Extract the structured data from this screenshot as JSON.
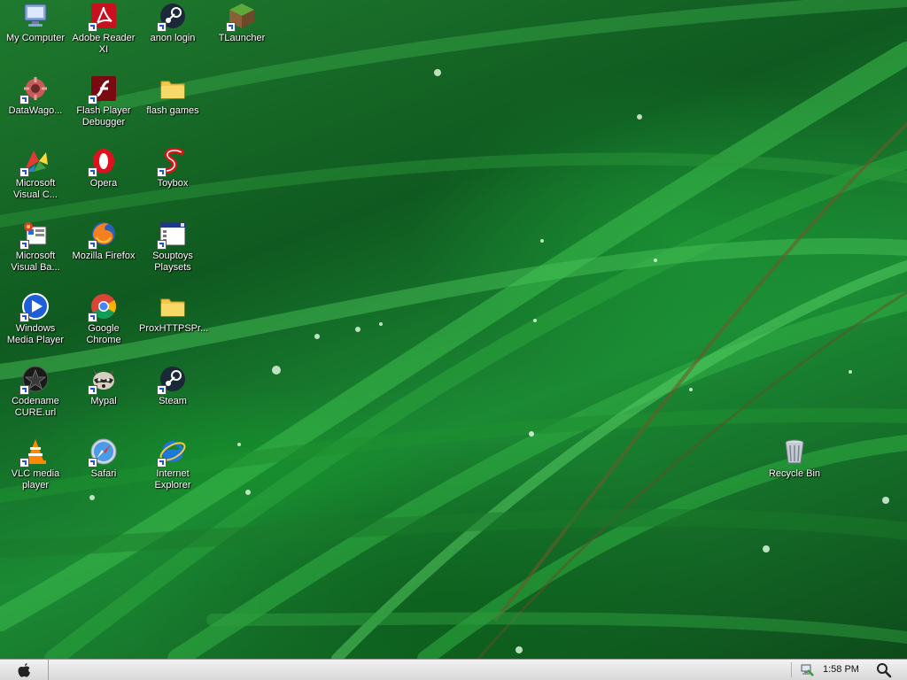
{
  "desktop": {
    "icons": [
      {
        "label": "My Computer",
        "icon": "my-computer-icon"
      },
      {
        "label": "Adobe Reader XI",
        "icon": "adobe-reader-icon"
      },
      {
        "label": "anon login",
        "icon": "steam-icon"
      },
      {
        "label": "TLauncher",
        "icon": "tlauncher-icon"
      },
      {
        "label": "DataWago...",
        "icon": "datawago-icon"
      },
      {
        "label": "Flash Player Debugger",
        "icon": "flash-player-icon"
      },
      {
        "label": "flash games",
        "icon": "folder-icon"
      },
      {
        "label": "Microsoft Visual C...",
        "icon": "visual-c-icon"
      },
      {
        "label": "Opera",
        "icon": "opera-icon"
      },
      {
        "label": "Toybox",
        "icon": "toybox-icon"
      },
      {
        "label": "Microsoft Visual Ba...",
        "icon": "visual-basic-icon"
      },
      {
        "label": "Mozilla Firefox",
        "icon": "firefox-icon"
      },
      {
        "label": "Souptoys Playsets",
        "icon": "window-app-icon"
      },
      {
        "label": "Windows Media Player",
        "icon": "media-player-icon"
      },
      {
        "label": "Google Chrome",
        "icon": "chrome-icon"
      },
      {
        "label": "ProxHTTPSPr...",
        "icon": "folder-icon"
      },
      {
        "label": "Codename CURE.url",
        "icon": "star-icon"
      },
      {
        "label": "Mypal",
        "icon": "raccoon-icon"
      },
      {
        "label": "Steam",
        "icon": "steam-icon"
      },
      {
        "label": "VLC media player",
        "icon": "vlc-icon"
      },
      {
        "label": "Safari",
        "icon": "safari-icon"
      },
      {
        "label": "Internet Explorer",
        "icon": "ie-icon"
      },
      {
        "label": "Recycle Bin",
        "icon": "recycle-bin-icon"
      }
    ]
  },
  "taskbar": {
    "start_icon": "apple-logo-icon",
    "tray_icon": "network-icon",
    "clock": "1:58 PM",
    "search_icon": "magnifier-icon"
  },
  "colors": {
    "wallpaper_primary": "#1f7a2e",
    "wallpaper_dark": "#0d4b1a",
    "taskbar_bg": "#e6e6e6",
    "label_text": "#ffffff"
  }
}
